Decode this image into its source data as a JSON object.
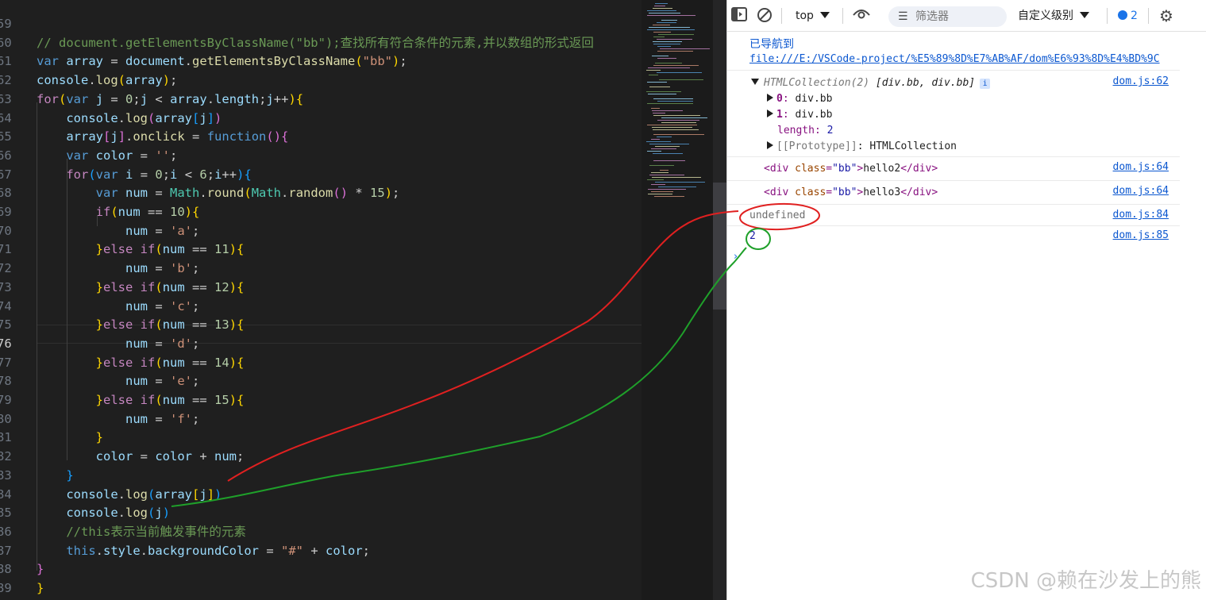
{
  "editor": {
    "lines": [
      {
        "n": "59",
        "tokens": []
      },
      {
        "n": "60",
        "tokens": [
          [
            "t-comment",
            "// document.getElementsByClassName(\"bb\");查找所有符合条件的元素,并以数组的形式返回"
          ]
        ]
      },
      {
        "n": "61",
        "tokens": [
          [
            "t-kw",
            "var"
          ],
          [
            "t-p",
            " "
          ],
          [
            "t-var",
            "array"
          ],
          [
            "t-p",
            " = "
          ],
          [
            "t-var",
            "document"
          ],
          [
            "t-p",
            "."
          ],
          [
            "t-fn",
            "getElementsByClassName"
          ],
          [
            "t-b1",
            "("
          ],
          [
            "t-str",
            "\"bb\""
          ],
          [
            "t-b1",
            ")"
          ],
          [
            "t-p",
            ";"
          ]
        ]
      },
      {
        "n": "62",
        "tokens": [
          [
            "t-var",
            "console"
          ],
          [
            "t-p",
            "."
          ],
          [
            "t-fn",
            "log"
          ],
          [
            "t-b1",
            "("
          ],
          [
            "t-var",
            "array"
          ],
          [
            "t-b1",
            ")"
          ],
          [
            "t-p",
            ";"
          ]
        ]
      },
      {
        "n": "63",
        "tokens": [
          [
            "t-ctl",
            "for"
          ],
          [
            "t-b1",
            "("
          ],
          [
            "t-kw",
            "var"
          ],
          [
            "t-p",
            " "
          ],
          [
            "t-var",
            "j"
          ],
          [
            "t-p",
            " = "
          ],
          [
            "t-num",
            "0"
          ],
          [
            "t-p",
            ";"
          ],
          [
            "t-var",
            "j"
          ],
          [
            "t-p",
            " < "
          ],
          [
            "t-var",
            "array"
          ],
          [
            "t-p",
            "."
          ],
          [
            "t-var",
            "length"
          ],
          [
            "t-p",
            ";"
          ],
          [
            "t-var",
            "j"
          ],
          [
            "t-p",
            "++"
          ],
          [
            "t-b1",
            ")"
          ],
          [
            "t-b1",
            "{"
          ]
        ]
      },
      {
        "n": "64",
        "tokens": [
          [
            "t-p",
            "    "
          ],
          [
            "t-var",
            "console"
          ],
          [
            "t-p",
            "."
          ],
          [
            "t-fn",
            "log"
          ],
          [
            "t-b2",
            "("
          ],
          [
            "t-var",
            "array"
          ],
          [
            "t-b3",
            "["
          ],
          [
            "t-var",
            "j"
          ],
          [
            "t-b3",
            "]"
          ],
          [
            "t-b2",
            ")"
          ]
        ]
      },
      {
        "n": "65",
        "tokens": [
          [
            "t-p",
            "    "
          ],
          [
            "t-var",
            "array"
          ],
          [
            "t-b2",
            "["
          ],
          [
            "t-var",
            "j"
          ],
          [
            "t-b2",
            "]"
          ],
          [
            "t-p",
            "."
          ],
          [
            "t-fn",
            "onclick"
          ],
          [
            "t-p",
            " = "
          ],
          [
            "t-kw",
            "function"
          ],
          [
            "t-b2",
            "()"
          ],
          [
            "t-b2",
            "{"
          ]
        ]
      },
      {
        "n": "66",
        "tokens": [
          [
            "t-p",
            "    "
          ],
          [
            "t-kw",
            "var"
          ],
          [
            "t-p",
            " "
          ],
          [
            "t-var",
            "color"
          ],
          [
            "t-p",
            " = "
          ],
          [
            "t-str",
            "''"
          ],
          [
            "t-p",
            ";"
          ]
        ]
      },
      {
        "n": "67",
        "tokens": [
          [
            "t-p",
            "    "
          ],
          [
            "t-ctl",
            "for"
          ],
          [
            "t-b3",
            "("
          ],
          [
            "t-kw",
            "var"
          ],
          [
            "t-p",
            " "
          ],
          [
            "t-var",
            "i"
          ],
          [
            "t-p",
            " = "
          ],
          [
            "t-num",
            "0"
          ],
          [
            "t-p",
            ";"
          ],
          [
            "t-var",
            "i"
          ],
          [
            "t-p",
            " < "
          ],
          [
            "t-num",
            "6"
          ],
          [
            "t-p",
            ";"
          ],
          [
            "t-var",
            "i"
          ],
          [
            "t-p",
            "++"
          ],
          [
            "t-b3",
            ")"
          ],
          [
            "t-b3",
            "{"
          ]
        ]
      },
      {
        "n": "68",
        "tokens": [
          [
            "t-p",
            "        "
          ],
          [
            "t-kw",
            "var"
          ],
          [
            "t-p",
            " "
          ],
          [
            "t-var",
            "num"
          ],
          [
            "t-p",
            " = "
          ],
          [
            "t-cls",
            "Math"
          ],
          [
            "t-p",
            "."
          ],
          [
            "t-fn",
            "round"
          ],
          [
            "t-b1",
            "("
          ],
          [
            "t-cls",
            "Math"
          ],
          [
            "t-p",
            "."
          ],
          [
            "t-fn",
            "random"
          ],
          [
            "t-b2",
            "()"
          ],
          [
            "t-p",
            " * "
          ],
          [
            "t-num",
            "15"
          ],
          [
            "t-b1",
            ")"
          ],
          [
            "t-p",
            ";"
          ]
        ]
      },
      {
        "n": "69",
        "tokens": [
          [
            "t-p",
            "        "
          ],
          [
            "t-ctl",
            "if"
          ],
          [
            "t-b1",
            "("
          ],
          [
            "t-var",
            "num"
          ],
          [
            "t-p",
            " == "
          ],
          [
            "t-num",
            "10"
          ],
          [
            "t-b1",
            ")"
          ],
          [
            "t-b1",
            "{"
          ]
        ]
      },
      {
        "n": "70",
        "tokens": [
          [
            "t-p",
            "            "
          ],
          [
            "t-var",
            "num"
          ],
          [
            "t-p",
            " = "
          ],
          [
            "t-str",
            "'a'"
          ],
          [
            "t-p",
            ";"
          ]
        ]
      },
      {
        "n": "71",
        "tokens": [
          [
            "t-p",
            "        "
          ],
          [
            "t-b1",
            "}"
          ],
          [
            "t-ctl",
            "else"
          ],
          [
            "t-p",
            " "
          ],
          [
            "t-ctl",
            "if"
          ],
          [
            "t-b1",
            "("
          ],
          [
            "t-var",
            "num"
          ],
          [
            "t-p",
            " == "
          ],
          [
            "t-num",
            "11"
          ],
          [
            "t-b1",
            ")"
          ],
          [
            "t-b1",
            "{"
          ]
        ]
      },
      {
        "n": "72",
        "tokens": [
          [
            "t-p",
            "            "
          ],
          [
            "t-var",
            "num"
          ],
          [
            "t-p",
            " = "
          ],
          [
            "t-str",
            "'b'"
          ],
          [
            "t-p",
            ";"
          ]
        ]
      },
      {
        "n": "73",
        "tokens": [
          [
            "t-p",
            "        "
          ],
          [
            "t-b1",
            "}"
          ],
          [
            "t-ctl",
            "else"
          ],
          [
            "t-p",
            " "
          ],
          [
            "t-ctl",
            "if"
          ],
          [
            "t-b1",
            "("
          ],
          [
            "t-var",
            "num"
          ],
          [
            "t-p",
            " == "
          ],
          [
            "t-num",
            "12"
          ],
          [
            "t-b1",
            ")"
          ],
          [
            "t-b1",
            "{"
          ]
        ]
      },
      {
        "n": "74",
        "tokens": [
          [
            "t-p",
            "            "
          ],
          [
            "t-var",
            "num"
          ],
          [
            "t-p",
            " = "
          ],
          [
            "t-str",
            "'c'"
          ],
          [
            "t-p",
            ";"
          ]
        ]
      },
      {
        "n": "75",
        "tokens": [
          [
            "t-p",
            "        "
          ],
          [
            "t-b1",
            "}"
          ],
          [
            "t-ctl",
            "else"
          ],
          [
            "t-p",
            " "
          ],
          [
            "t-ctl",
            "if"
          ],
          [
            "t-b1",
            "("
          ],
          [
            "t-var",
            "num"
          ],
          [
            "t-p",
            " == "
          ],
          [
            "t-num",
            "13"
          ],
          [
            "t-b1",
            ")"
          ],
          [
            "t-b1",
            "{"
          ]
        ]
      },
      {
        "n": "76",
        "tokens": [
          [
            "t-p",
            "            "
          ],
          [
            "t-var",
            "num"
          ],
          [
            "t-p",
            " = "
          ],
          [
            "t-str",
            "'d'"
          ],
          [
            "t-p",
            ";"
          ]
        ]
      },
      {
        "n": "77",
        "tokens": [
          [
            "t-p",
            "        "
          ],
          [
            "t-b1",
            "}"
          ],
          [
            "t-ctl",
            "else"
          ],
          [
            "t-p",
            " "
          ],
          [
            "t-ctl",
            "if"
          ],
          [
            "t-b1",
            "("
          ],
          [
            "t-var",
            "num"
          ],
          [
            "t-p",
            " == "
          ],
          [
            "t-num",
            "14"
          ],
          [
            "t-b1",
            ")"
          ],
          [
            "t-b1",
            "{"
          ]
        ]
      },
      {
        "n": "78",
        "tokens": [
          [
            "t-p",
            "            "
          ],
          [
            "t-var",
            "num"
          ],
          [
            "t-p",
            " = "
          ],
          [
            "t-str",
            "'e'"
          ],
          [
            "t-p",
            ";"
          ]
        ]
      },
      {
        "n": "79",
        "tokens": [
          [
            "t-p",
            "        "
          ],
          [
            "t-b1",
            "}"
          ],
          [
            "t-ctl",
            "else"
          ],
          [
            "t-p",
            " "
          ],
          [
            "t-ctl",
            "if"
          ],
          [
            "t-b1",
            "("
          ],
          [
            "t-var",
            "num"
          ],
          [
            "t-p",
            " == "
          ],
          [
            "t-num",
            "15"
          ],
          [
            "t-b1",
            ")"
          ],
          [
            "t-b1",
            "{"
          ]
        ]
      },
      {
        "n": "80",
        "tokens": [
          [
            "t-p",
            "            "
          ],
          [
            "t-var",
            "num"
          ],
          [
            "t-p",
            " = "
          ],
          [
            "t-str",
            "'f'"
          ],
          [
            "t-p",
            ";"
          ]
        ]
      },
      {
        "n": "81",
        "tokens": [
          [
            "t-p",
            "        "
          ],
          [
            "t-b1",
            "}"
          ]
        ]
      },
      {
        "n": "82",
        "tokens": [
          [
            "t-p",
            "        "
          ],
          [
            "t-var",
            "color"
          ],
          [
            "t-p",
            " = "
          ],
          [
            "t-var",
            "color"
          ],
          [
            "t-p",
            " + "
          ],
          [
            "t-var",
            "num"
          ],
          [
            "t-p",
            ";"
          ]
        ]
      },
      {
        "n": "83",
        "tokens": [
          [
            "t-p",
            "    "
          ],
          [
            "t-b3",
            "}"
          ]
        ]
      },
      {
        "n": "84",
        "tokens": [
          [
            "t-p",
            "    "
          ],
          [
            "t-var",
            "console"
          ],
          [
            "t-p",
            "."
          ],
          [
            "t-fn",
            "log"
          ],
          [
            "t-b3",
            "("
          ],
          [
            "t-var",
            "array"
          ],
          [
            "t-b1",
            "["
          ],
          [
            "t-var",
            "j"
          ],
          [
            "t-b1",
            "]"
          ],
          [
            "t-b3",
            ")"
          ]
        ]
      },
      {
        "n": "85",
        "tokens": [
          [
            "t-p",
            "    "
          ],
          [
            "t-var",
            "console"
          ],
          [
            "t-p",
            "."
          ],
          [
            "t-fn",
            "log"
          ],
          [
            "t-b3",
            "("
          ],
          [
            "t-var",
            "j"
          ],
          [
            "t-b3",
            ")"
          ]
        ]
      },
      {
        "n": "86",
        "tokens": [
          [
            "t-p",
            "    "
          ],
          [
            "t-comment",
            "//this表示当前触发事件的元素"
          ]
        ]
      },
      {
        "n": "87",
        "tokens": [
          [
            "t-p",
            "    "
          ],
          [
            "t-kw",
            "this"
          ],
          [
            "t-p",
            "."
          ],
          [
            "t-var",
            "style"
          ],
          [
            "t-p",
            "."
          ],
          [
            "t-var",
            "backgroundColor"
          ],
          [
            "t-p",
            " = "
          ],
          [
            "t-str",
            "\"#\""
          ],
          [
            "t-p",
            " + "
          ],
          [
            "t-var",
            "color"
          ],
          [
            "t-p",
            ";"
          ]
        ]
      },
      {
        "n": "88",
        "tokens": [
          [
            "t-b2",
            "}"
          ]
        ]
      },
      {
        "n": "89",
        "tokens": [
          [
            "t-b1",
            "}"
          ]
        ]
      }
    ],
    "active_line": "76"
  },
  "toolbar": {
    "context": "top",
    "filter_placeholder": "筛选器",
    "level": "自定义级别",
    "issues_count": "2"
  },
  "console": {
    "nav_title": "已导航到",
    "nav_url": "file:///E:/VSCode-project/%E5%89%8D%E7%AB%AF/dom%E6%93%8D%E4%BD%9C",
    "collection_type": "HTMLCollection(2)",
    "collection_items": "[div.bb, div.bb]",
    "collection_src": "dom.js:62",
    "entry0_key": "0",
    "entry0_val": "div.bb",
    "entry1_key": "1",
    "entry1_val": "div.bb",
    "length_key": "length",
    "length_val": "2",
    "proto_key": "[[Prototype]]",
    "proto_val": "HTMLCollection",
    "div1_text": "hello2",
    "div1_src": "dom.js:64",
    "div2_text": "hello3",
    "div2_src": "dom.js:64",
    "undefined_text": "undefined",
    "undefined_src": "dom.js:84",
    "two_text": "2",
    "two_src": "dom.js:85",
    "tag_open": "<div",
    "attr_name": "class",
    "attr_value": "\"bb\"",
    "tag_close_start": ">",
    "tag_end": "</div>"
  },
  "watermark": "CSDN @赖在沙发上的熊",
  "colors": {
    "annotation_red": "#e02020",
    "annotation_green": "#1fa02a"
  }
}
